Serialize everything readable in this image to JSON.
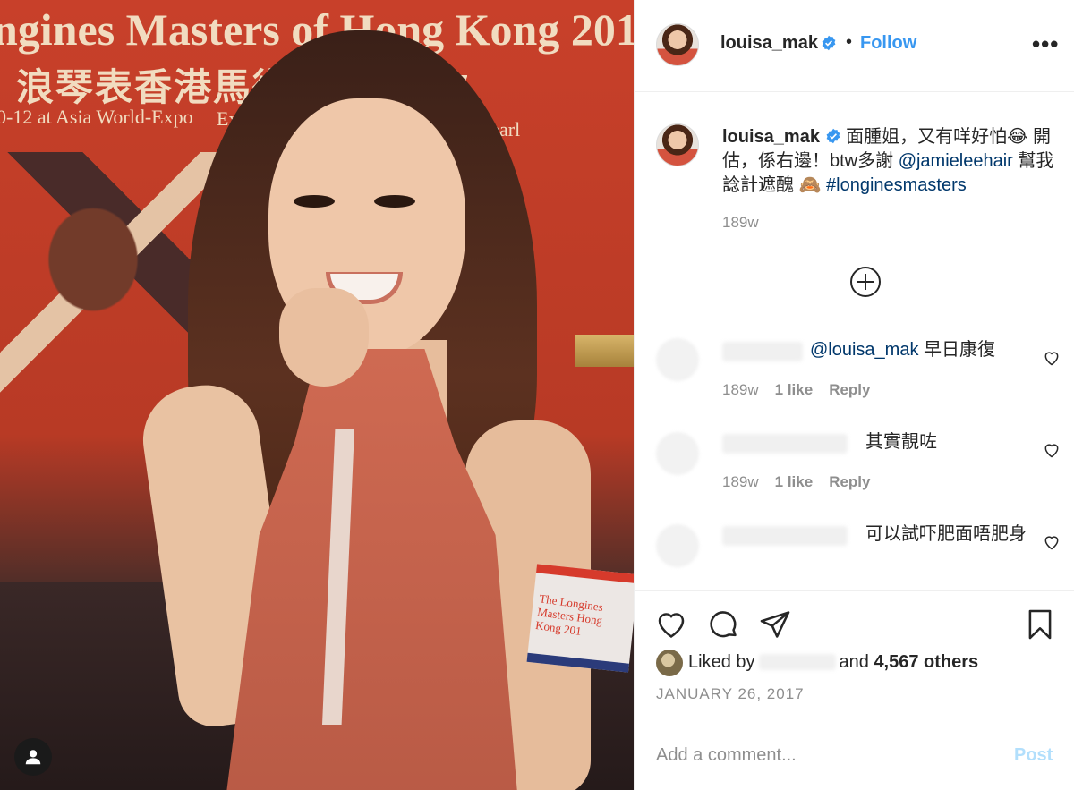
{
  "photo": {
    "backdrop_line1": "ngines Masters of Hong Kong 201",
    "backdrop_line2": "浪琴表香港馬術　　　　7",
    "backdrop_line3": "0-12 at Asia World-Expo",
    "backdrop_line4": "Excl",
    "backdrop_line5": "Pearl",
    "armband_text": "The Longines Masters Hong Kong 201",
    "profile_icon": "user-icon"
  },
  "header": {
    "username": "louisa_mak",
    "verified_icon": "verified-badge-icon",
    "separator": "•",
    "follow_label": "Follow",
    "more_icon": "more-options-icon",
    "more_label": "•••"
  },
  "caption": {
    "username": "louisa_mak",
    "text_part1": " 面腫姐，又有咩好怕😂 開估，係右邊！btw多謝 ",
    "mention": "@jamieleehair",
    "text_part2": " 幫我諗計遮醜 🙈 ",
    "hashtag": "#longinesmasters",
    "time": "189w"
  },
  "load_more_icon": "plus-circle-icon",
  "comments": [
    {
      "mention": "@louisa_mak",
      "text": " 早日康復",
      "time": "189w",
      "likes": "1 like",
      "reply": "Reply"
    },
    {
      "text": "其實靚咗",
      "time": "189w",
      "likes": "1 like",
      "reply": "Reply"
    },
    {
      "text": "可以試吓肥面唔肥身"
    }
  ],
  "actions": {
    "like_icon": "heart-icon",
    "comment_icon": "comment-icon",
    "share_icon": "share-icon",
    "save_icon": "bookmark-icon"
  },
  "likes": {
    "prefix": "Liked by",
    "connector": "and",
    "others": "4,567 others"
  },
  "date": "JANUARY 26, 2017",
  "add_comment": {
    "placeholder": "Add a comment...",
    "post_label": "Post"
  },
  "colors": {
    "link_blue": "#3897f0",
    "post_disabled": "#b2dffc",
    "muted_text": "#8e8e8e",
    "dress": "#c8634d"
  }
}
